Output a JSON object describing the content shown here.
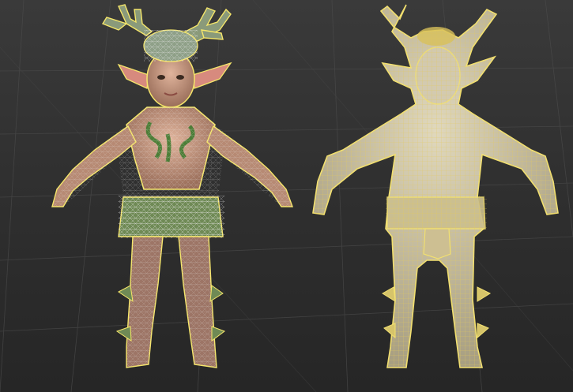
{
  "viewport": {
    "background_top": "#3a3a3a",
    "background_bottom": "#262626",
    "grid_color": "#4a4a4a",
    "selection_color": "#f5e66a"
  },
  "models": [
    {
      "name": "textured-wireframe-model",
      "state": "selected",
      "skin_color": "#c99780",
      "foliage_color": "#6f8a55",
      "tattoo_color": "#3f7a2f",
      "wire_color": "#e8e8e8"
    },
    {
      "name": "shaded-wireframe-model",
      "state": "selected",
      "body_color": "#c9c0a3",
      "wire_color": "#e6d16a"
    }
  ]
}
